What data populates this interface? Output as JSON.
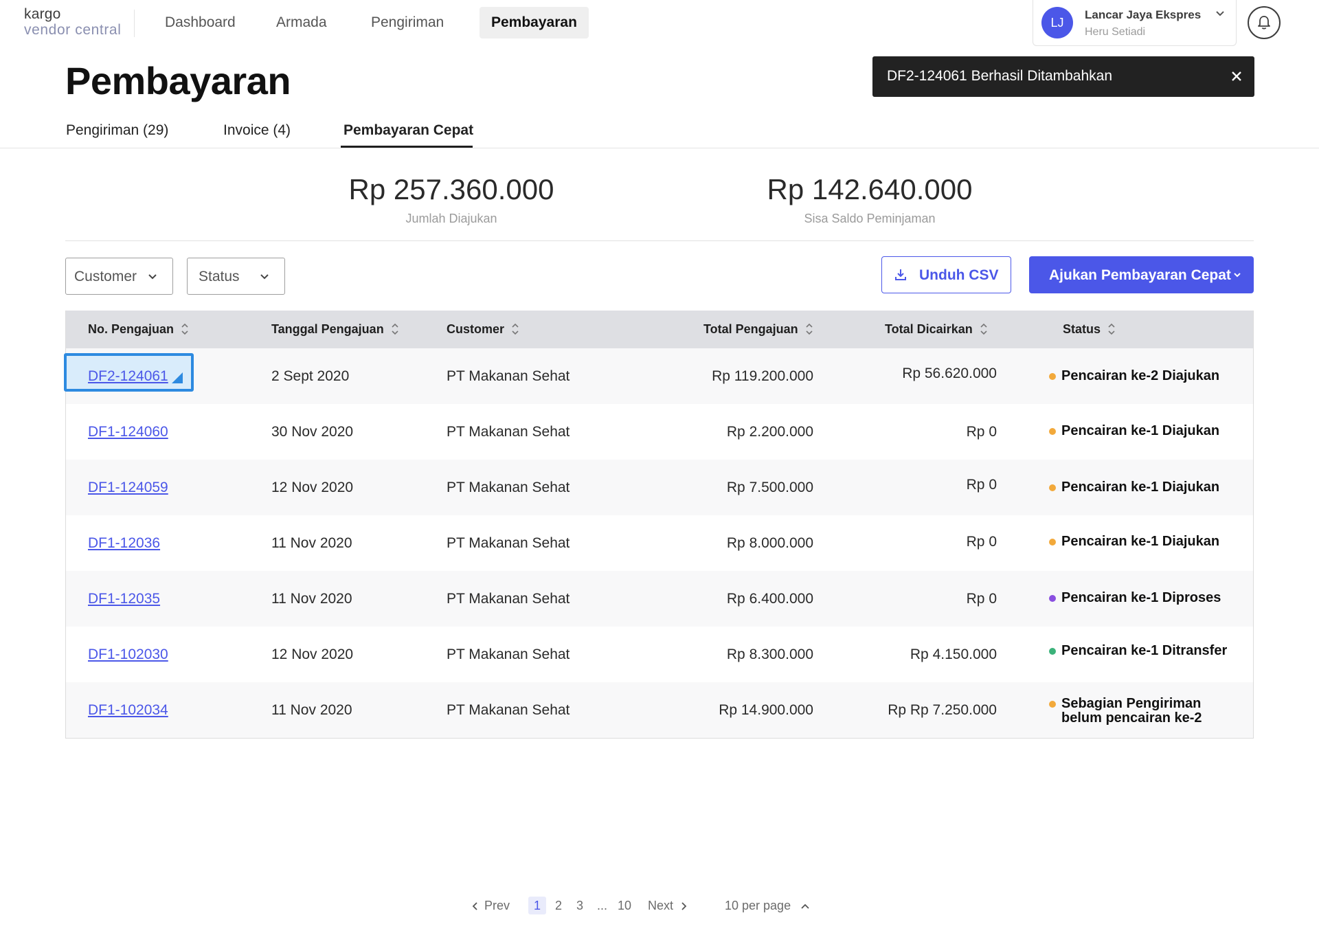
{
  "brand": {
    "line1": "kargo",
    "line2": "vendor central"
  },
  "nav": [
    {
      "label": "Dashboard"
    },
    {
      "label": "Armada"
    },
    {
      "label": "Pengiriman"
    },
    {
      "label": "Pembayaran",
      "active": true
    }
  ],
  "account": {
    "initials": "LJ",
    "company": "Lancar Jaya Ekspres",
    "user": "Heru Setiadi"
  },
  "page": {
    "title": "Pembayaran"
  },
  "toast": {
    "message": "DF2-124061 Berhasil Ditambahkan"
  },
  "tabs": [
    {
      "label": "Pengiriman (29)"
    },
    {
      "label": "Invoice (4)"
    },
    {
      "label": "Pembayaran Cepat",
      "active": true
    }
  ],
  "summary": [
    {
      "amount": "Rp 257.360.000",
      "label": "Jumlah Diajukan"
    },
    {
      "amount": "Rp 142.640.000",
      "label": "Sisa Saldo Peminjaman"
    }
  ],
  "filters": {
    "customer": "Customer",
    "status": "Status"
  },
  "actions": {
    "download": "Unduh CSV",
    "submit": "Ajukan Pembayaran Cepat"
  },
  "table": {
    "headers": [
      "No. Pengajuan",
      "Tanggal Pengajuan",
      "Customer",
      "Total Pengajuan",
      "Total Dicairkan",
      "Status"
    ],
    "rows": [
      {
        "id": "DF2-124061",
        "date": "2 Sept 2020",
        "customer": "PT Makanan Sehat",
        "total": "Rp 119.200.000",
        "disbursed": "Rp 56.620.000",
        "status": "Pencairan ke-2 Diajukan",
        "status_color": "#f2a93b"
      },
      {
        "id": "DF1-124060",
        "date": "30 Nov 2020",
        "customer": "PT Makanan Sehat",
        "total": "Rp 2.200.000",
        "disbursed": "Rp 0",
        "status": "Pencairan ke-1 Diajukan",
        "status_color": "#f2a93b"
      },
      {
        "id": "DF1-124059",
        "date": "12 Nov 2020",
        "customer": "PT Makanan Sehat",
        "total": "Rp 7.500.000",
        "disbursed": "Rp 0",
        "status": "Pencairan ke-1 Diajukan",
        "status_color": "#f2a93b"
      },
      {
        "id": "DF1-12036",
        "date": "11 Nov 2020",
        "customer": "PT Makanan Sehat",
        "total": "Rp 8.000.000",
        "disbursed": "Rp 0",
        "status": "Pencairan ke-1 Diajukan",
        "status_color": "#f2a93b"
      },
      {
        "id": "DF1-12035",
        "date": "11 Nov 2020",
        "customer": "PT Makanan Sehat",
        "total": "Rp 6.400.000",
        "disbursed": "Rp 0",
        "status": "Pencairan ke-1 Diproses",
        "status_color": "#8a4fe0"
      },
      {
        "id": "DF1-102030",
        "date": "12 Nov 2020",
        "customer": "PT Makanan Sehat",
        "total": "Rp 8.300.000",
        "disbursed": "Rp 4.150.000",
        "status": "Pencairan ke-1 Ditransfer",
        "status_color": "#3bb27a"
      },
      {
        "id": "DF1-102034",
        "date": "11 Nov 2020",
        "customer": "PT Makanan Sehat",
        "total": "Rp 14.900.000",
        "disbursed": "Rp Rp 7.250.000",
        "status_line1": "Sebagian Pengiriman",
        "status_line2": "belum pencairan ke-2",
        "status_color": "#f2a93b"
      }
    ]
  },
  "pagination": {
    "prev": "Prev",
    "pages": [
      "1",
      "2",
      "3",
      "...",
      "10"
    ],
    "next": "Next",
    "per_page": "10 per page"
  }
}
